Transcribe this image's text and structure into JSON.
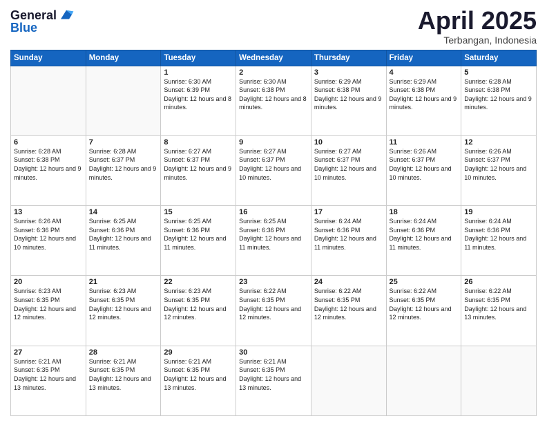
{
  "logo": {
    "line1": "General",
    "line2": "Blue"
  },
  "header": {
    "month": "April 2025",
    "location": "Terbangan, Indonesia"
  },
  "days_of_week": [
    "Sunday",
    "Monday",
    "Tuesday",
    "Wednesday",
    "Thursday",
    "Friday",
    "Saturday"
  ],
  "weeks": [
    [
      {
        "day": "",
        "sunrise": "",
        "sunset": "",
        "daylight": ""
      },
      {
        "day": "",
        "sunrise": "",
        "sunset": "",
        "daylight": ""
      },
      {
        "day": "1",
        "sunrise": "Sunrise: 6:30 AM",
        "sunset": "Sunset: 6:39 PM",
        "daylight": "Daylight: 12 hours and 8 minutes."
      },
      {
        "day": "2",
        "sunrise": "Sunrise: 6:30 AM",
        "sunset": "Sunset: 6:38 PM",
        "daylight": "Daylight: 12 hours and 8 minutes."
      },
      {
        "day": "3",
        "sunrise": "Sunrise: 6:29 AM",
        "sunset": "Sunset: 6:38 PM",
        "daylight": "Daylight: 12 hours and 9 minutes."
      },
      {
        "day": "4",
        "sunrise": "Sunrise: 6:29 AM",
        "sunset": "Sunset: 6:38 PM",
        "daylight": "Daylight: 12 hours and 9 minutes."
      },
      {
        "day": "5",
        "sunrise": "Sunrise: 6:28 AM",
        "sunset": "Sunset: 6:38 PM",
        "daylight": "Daylight: 12 hours and 9 minutes."
      }
    ],
    [
      {
        "day": "6",
        "sunrise": "Sunrise: 6:28 AM",
        "sunset": "Sunset: 6:38 PM",
        "daylight": "Daylight: 12 hours and 9 minutes."
      },
      {
        "day": "7",
        "sunrise": "Sunrise: 6:28 AM",
        "sunset": "Sunset: 6:37 PM",
        "daylight": "Daylight: 12 hours and 9 minutes."
      },
      {
        "day": "8",
        "sunrise": "Sunrise: 6:27 AM",
        "sunset": "Sunset: 6:37 PM",
        "daylight": "Daylight: 12 hours and 9 minutes."
      },
      {
        "day": "9",
        "sunrise": "Sunrise: 6:27 AM",
        "sunset": "Sunset: 6:37 PM",
        "daylight": "Daylight: 12 hours and 10 minutes."
      },
      {
        "day": "10",
        "sunrise": "Sunrise: 6:27 AM",
        "sunset": "Sunset: 6:37 PM",
        "daylight": "Daylight: 12 hours and 10 minutes."
      },
      {
        "day": "11",
        "sunrise": "Sunrise: 6:26 AM",
        "sunset": "Sunset: 6:37 PM",
        "daylight": "Daylight: 12 hours and 10 minutes."
      },
      {
        "day": "12",
        "sunrise": "Sunrise: 6:26 AM",
        "sunset": "Sunset: 6:37 PM",
        "daylight": "Daylight: 12 hours and 10 minutes."
      }
    ],
    [
      {
        "day": "13",
        "sunrise": "Sunrise: 6:26 AM",
        "sunset": "Sunset: 6:36 PM",
        "daylight": "Daylight: 12 hours and 10 minutes."
      },
      {
        "day": "14",
        "sunrise": "Sunrise: 6:25 AM",
        "sunset": "Sunset: 6:36 PM",
        "daylight": "Daylight: 12 hours and 11 minutes."
      },
      {
        "day": "15",
        "sunrise": "Sunrise: 6:25 AM",
        "sunset": "Sunset: 6:36 PM",
        "daylight": "Daylight: 12 hours and 11 minutes."
      },
      {
        "day": "16",
        "sunrise": "Sunrise: 6:25 AM",
        "sunset": "Sunset: 6:36 PM",
        "daylight": "Daylight: 12 hours and 11 minutes."
      },
      {
        "day": "17",
        "sunrise": "Sunrise: 6:24 AM",
        "sunset": "Sunset: 6:36 PM",
        "daylight": "Daylight: 12 hours and 11 minutes."
      },
      {
        "day": "18",
        "sunrise": "Sunrise: 6:24 AM",
        "sunset": "Sunset: 6:36 PM",
        "daylight": "Daylight: 12 hours and 11 minutes."
      },
      {
        "day": "19",
        "sunrise": "Sunrise: 6:24 AM",
        "sunset": "Sunset: 6:36 PM",
        "daylight": "Daylight: 12 hours and 11 minutes."
      }
    ],
    [
      {
        "day": "20",
        "sunrise": "Sunrise: 6:23 AM",
        "sunset": "Sunset: 6:35 PM",
        "daylight": "Daylight: 12 hours and 12 minutes."
      },
      {
        "day": "21",
        "sunrise": "Sunrise: 6:23 AM",
        "sunset": "Sunset: 6:35 PM",
        "daylight": "Daylight: 12 hours and 12 minutes."
      },
      {
        "day": "22",
        "sunrise": "Sunrise: 6:23 AM",
        "sunset": "Sunset: 6:35 PM",
        "daylight": "Daylight: 12 hours and 12 minutes."
      },
      {
        "day": "23",
        "sunrise": "Sunrise: 6:22 AM",
        "sunset": "Sunset: 6:35 PM",
        "daylight": "Daylight: 12 hours and 12 minutes."
      },
      {
        "day": "24",
        "sunrise": "Sunrise: 6:22 AM",
        "sunset": "Sunset: 6:35 PM",
        "daylight": "Daylight: 12 hours and 12 minutes."
      },
      {
        "day": "25",
        "sunrise": "Sunrise: 6:22 AM",
        "sunset": "Sunset: 6:35 PM",
        "daylight": "Daylight: 12 hours and 12 minutes."
      },
      {
        "day": "26",
        "sunrise": "Sunrise: 6:22 AM",
        "sunset": "Sunset: 6:35 PM",
        "daylight": "Daylight: 12 hours and 13 minutes."
      }
    ],
    [
      {
        "day": "27",
        "sunrise": "Sunrise: 6:21 AM",
        "sunset": "Sunset: 6:35 PM",
        "daylight": "Daylight: 12 hours and 13 minutes."
      },
      {
        "day": "28",
        "sunrise": "Sunrise: 6:21 AM",
        "sunset": "Sunset: 6:35 PM",
        "daylight": "Daylight: 12 hours and 13 minutes."
      },
      {
        "day": "29",
        "sunrise": "Sunrise: 6:21 AM",
        "sunset": "Sunset: 6:35 PM",
        "daylight": "Daylight: 12 hours and 13 minutes."
      },
      {
        "day": "30",
        "sunrise": "Sunrise: 6:21 AM",
        "sunset": "Sunset: 6:35 PM",
        "daylight": "Daylight: 12 hours and 13 minutes."
      },
      {
        "day": "",
        "sunrise": "",
        "sunset": "",
        "daylight": ""
      },
      {
        "day": "",
        "sunrise": "",
        "sunset": "",
        "daylight": ""
      },
      {
        "day": "",
        "sunrise": "",
        "sunset": "",
        "daylight": ""
      }
    ]
  ]
}
